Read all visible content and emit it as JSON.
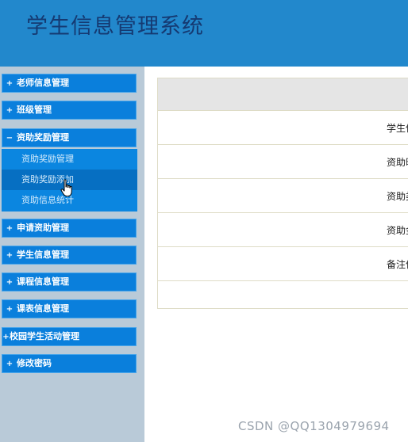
{
  "header": {
    "title": "学生信息管理系统"
  },
  "sidebar": {
    "items": [
      {
        "prefix": "+",
        "label": "老师信息管理"
      },
      {
        "prefix": "+",
        "label": "班级管理"
      },
      {
        "prefix": "−",
        "label": "资助奖励管理"
      },
      {
        "prefix": "+",
        "label": "申请资助管理"
      },
      {
        "prefix": "+",
        "label": "学生信息管理"
      },
      {
        "prefix": "+",
        "label": "课程信息管理"
      },
      {
        "prefix": "+",
        "label": "课表信息管理"
      },
      {
        "prefix": "+",
        "label": "校园学生活动管理"
      },
      {
        "prefix": "+",
        "label": "修改密码"
      }
    ],
    "submenu": [
      {
        "label": "资助奖励管理"
      },
      {
        "label": "资助奖励添加"
      },
      {
        "label": "资助信息统计"
      }
    ]
  },
  "form": {
    "rows": [
      {
        "label": "学生信"
      },
      {
        "label": "资助时"
      },
      {
        "label": "资助类"
      },
      {
        "label": "资助金"
      },
      {
        "label": "备注信"
      }
    ]
  },
  "watermark": "CSDN @QQ1304979694"
}
